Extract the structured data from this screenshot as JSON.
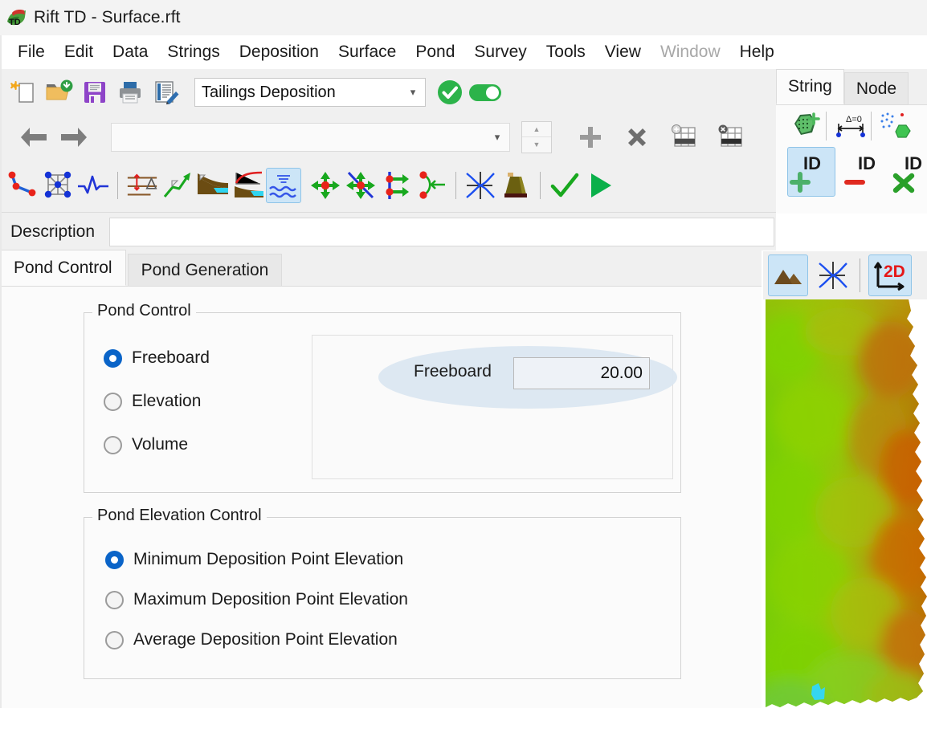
{
  "window": {
    "title": "Rift TD - Surface.rft",
    "app_icon": "rift-td-logo-icon"
  },
  "menubar": {
    "items": [
      {
        "label": "File",
        "disabled": false
      },
      {
        "label": "Edit",
        "disabled": false
      },
      {
        "label": "Data",
        "disabled": false
      },
      {
        "label": "Strings",
        "disabled": false
      },
      {
        "label": "Deposition",
        "disabled": false
      },
      {
        "label": "Surface",
        "disabled": false
      },
      {
        "label": "Pond",
        "disabled": false
      },
      {
        "label": "Survey",
        "disabled": false
      },
      {
        "label": "Tools",
        "disabled": false
      },
      {
        "label": "View",
        "disabled": false
      },
      {
        "label": "Window",
        "disabled": true
      },
      {
        "label": "Help",
        "disabled": false
      }
    ]
  },
  "toolbar_row1": {
    "buttons": [
      {
        "name": "new-file-button",
        "icon": "new-document-icon"
      },
      {
        "name": "open-file-button",
        "icon": "open-folder-icon"
      },
      {
        "name": "save-file-button",
        "icon": "floppy-disk-icon"
      },
      {
        "name": "print-button",
        "icon": "printer-icon"
      },
      {
        "name": "edit-report-button",
        "icon": "document-pencil-icon"
      }
    ],
    "mode_combo": {
      "value": "Tailings Deposition",
      "chevron": "chevron-down-icon"
    },
    "apply_button": "check-circle-green-icon",
    "toggle": {
      "name": "enable-toggle",
      "state": "on",
      "color": "#28b463"
    }
  },
  "toolbar_row2": {
    "back_button": "arrow-left-icon",
    "forward_button": "arrow-right-icon",
    "selection_combo": {
      "value": "",
      "placeholder": ""
    },
    "spinner": {
      "up": "spinner-up-icon",
      "down": "spinner-down-icon"
    },
    "buttons": [
      {
        "name": "add-item-button",
        "icon": "plus-icon"
      },
      {
        "name": "delete-item-button",
        "icon": "cross-icon"
      },
      {
        "name": "add-grid-row-button",
        "icon": "grid-add-icon"
      },
      {
        "name": "delete-grid-row-button",
        "icon": "grid-delete-icon"
      }
    ]
  },
  "toolbar_row3": {
    "buttons": [
      {
        "name": "string-points-button",
        "icon": "polyline-points-icon",
        "selected": false
      },
      {
        "name": "string-mesh-button",
        "icon": "mesh-nodes-icon",
        "selected": false
      },
      {
        "name": "profile-button",
        "icon": "waveform-icon",
        "selected": false
      },
      {
        "name": "elevation-delta-button",
        "icon": "contour-delta-icon",
        "selected": false
      },
      {
        "name": "slope-button",
        "icon": "green-slope-arrow-icon",
        "selected": false
      },
      {
        "name": "beach-profile-button",
        "icon": "beach-profile-icon",
        "selected": false
      },
      {
        "name": "beach-curve-button",
        "icon": "beach-curve-icon",
        "selected": false
      },
      {
        "name": "pond-water-button",
        "icon": "pond-water-icon",
        "selected": true
      },
      {
        "name": "move-point-button",
        "icon": "move-crosshair-icon",
        "selected": false
      },
      {
        "name": "intersect-point-button",
        "icon": "intersect-crosshair-icon",
        "selected": false
      },
      {
        "name": "offset-point-button",
        "icon": "offset-points-icon",
        "selected": false
      },
      {
        "name": "split-string-button",
        "icon": "split-string-icon",
        "selected": false
      },
      {
        "name": "flow-lines-button",
        "icon": "flow-lines-icon",
        "selected": false
      },
      {
        "name": "dam-button",
        "icon": "tailings-dam-icon",
        "selected": false
      },
      {
        "name": "validate-button",
        "icon": "check-green-icon",
        "selected": false
      },
      {
        "name": "run-button",
        "icon": "play-green-icon",
        "selected": false
      }
    ]
  },
  "right_panel": {
    "tabs": [
      {
        "label": "String",
        "active": true
      },
      {
        "label": "Node",
        "active": false
      }
    ],
    "buttons": [
      {
        "name": "add-string-button",
        "icon": "polygon-add-icon",
        "selected": false
      },
      {
        "name": "measure-delta-button",
        "icon": "delta-zero-measure-icon",
        "selected": false
      },
      {
        "name": "points-to-polygon-button",
        "icon": "points-to-polygon-icon",
        "selected": false
      },
      {
        "name": "add-id-button",
        "icon": "id-plus-icon",
        "label": "ID",
        "selected": true
      },
      {
        "name": "remove-id-button",
        "icon": "id-minus-icon",
        "label": "ID",
        "selected": false
      },
      {
        "name": "delete-id-button",
        "icon": "id-delete-icon",
        "label": "ID",
        "selected": false
      }
    ]
  },
  "description": {
    "label": "Description",
    "value": "",
    "placeholder": ""
  },
  "tabs": [
    {
      "label": "Pond Control",
      "active": true
    },
    {
      "label": "Pond Generation",
      "active": false
    }
  ],
  "pond_control": {
    "group_title": "Pond Control",
    "options": [
      {
        "label": "Freeboard",
        "selected": true
      },
      {
        "label": "Elevation",
        "selected": false
      },
      {
        "label": "Volume",
        "selected": false
      }
    ],
    "freeboard_field": {
      "label": "Freeboard",
      "value": "20.00",
      "highlighted": true,
      "highlight_color": "#dbe7f1"
    }
  },
  "pond_elevation_control": {
    "group_title": "Pond Elevation Control",
    "options": [
      {
        "label": "Minimum Deposition Point Elevation",
        "selected": true
      },
      {
        "label": "Maximum Deposition Point Elevation",
        "selected": false
      },
      {
        "label": "Average Deposition Point Elevation",
        "selected": false
      }
    ]
  },
  "viewport": {
    "view_buttons": [
      {
        "name": "terrain-view-button",
        "icon": "mountain-icon",
        "selected": true
      },
      {
        "name": "flow-view-button",
        "icon": "flow-lines-icon",
        "selected": false
      },
      {
        "name": "view-2d-button",
        "icon": "axes-2d-icon",
        "label": "2D",
        "selected": true
      }
    ],
    "map": {
      "name": "elevation-heatmap",
      "colors_low": "#6cd400",
      "colors_high": "#d15a00",
      "pond_color": "#35d6f0"
    }
  }
}
